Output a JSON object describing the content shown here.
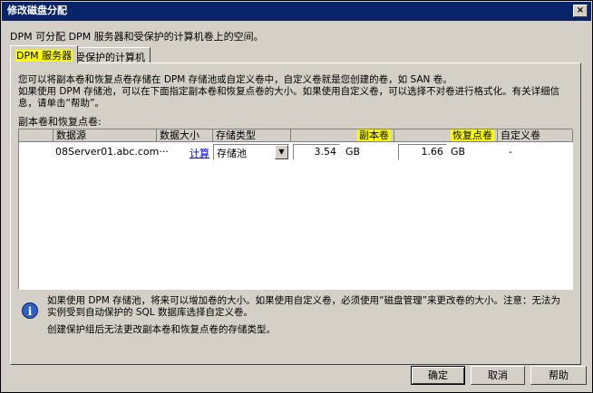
{
  "window": {
    "title": "修改磁盘分配",
    "close": "×"
  },
  "intro": "DPM 可分配 DPM 服务器和受保护的计算机卷上的空间。",
  "tabs": [
    {
      "label": "DPM 服务器"
    },
    {
      "label": "受保护的计算机"
    }
  ],
  "description": "您可以将副本卷和恢复点卷存储在 DPM 存储池或自定义卷中，自定义卷就是您创建的卷，如 SAN 卷。\n如果使用 DPM 存储池，可以在下面指定副本卷和恢复点卷的大小。如果使用自定义卷，可以选择不对卷进行格式化。有关详细信息，请单击“帮助”。",
  "grid": {
    "label": "副本卷和恢复点卷:",
    "headers": {
      "datasource": "数据源",
      "size": "数据大小",
      "storage_type": "存储类型",
      "replica": "副本卷",
      "recovery": "恢复点卷",
      "custom": "自定义卷"
    },
    "rows": [
      {
        "datasource": "08Server01.abc.com···",
        "size_link": "计算",
        "storage_type": "存储池",
        "replica_value": "3.54",
        "replica_unit": "GB",
        "recovery_value": "1.66",
        "recovery_unit": "GB",
        "custom": "-"
      }
    ]
  },
  "notes": {
    "line1": "如果使用 DPM 存储池，将来可以增加卷的大小。如果使用自定义卷，必须使用“磁盘管理”来更改卷的大小。注意：无法为实例受到自动保护的 SQL 数据库选择自定义卷。",
    "line2": "创建保护组后无法更改副本卷和恢复点卷的存储类型。"
  },
  "buttons": {
    "ok": "确定",
    "cancel": "取消",
    "help": "帮助"
  },
  "colors": {
    "highlight": "#ffff00",
    "titlebar": "#0a246a"
  }
}
